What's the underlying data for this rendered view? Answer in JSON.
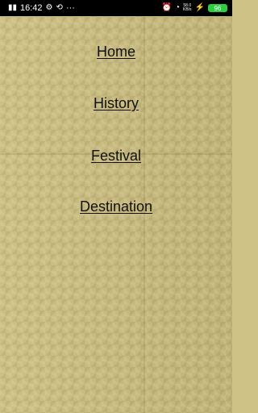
{
  "status_bar": {
    "time": "16:42",
    "more": "···",
    "speed_value": "58.0",
    "speed_unit": "KB/s",
    "battery": "96"
  },
  "menu": {
    "home": "Home",
    "history": "History",
    "festival": "Festival",
    "destination": "Destination"
  }
}
